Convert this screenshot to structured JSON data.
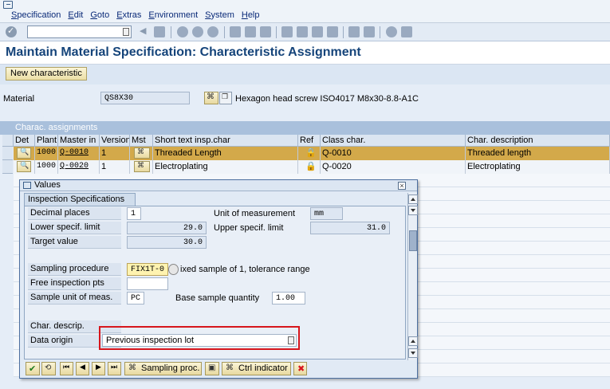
{
  "menubar": {
    "items": [
      "Specification",
      "Edit",
      "Goto",
      "Extras",
      "Environment",
      "System",
      "Help"
    ]
  },
  "titlebar": {
    "title": "Maintain Material Specification: Characteristic Assignment"
  },
  "apptoolbar": {
    "new_characteristic": "New characteristic"
  },
  "header": {
    "material_label": "Material",
    "material_value": "QS8X30",
    "material_description": "Hexagon head screw ISO4017 M8x30-8.8-A1C"
  },
  "assignments": {
    "title": "Charac. assignments",
    "columns": [
      "Det",
      "Plant",
      "Master in",
      "Version",
      "Mst",
      "Short text insp.char",
      "Ref",
      "Class char.",
      "Char. description"
    ],
    "rows": [
      {
        "plant": "1000",
        "master": "Q-0010",
        "version": "1",
        "short_text": "Threaded Length",
        "class_char": "Q-0010",
        "description": "Threaded length"
      },
      {
        "plant": "1000",
        "master": "Q-0020",
        "version": "1",
        "short_text": "Electroplating",
        "class_char": "Q-0020",
        "description": "Electroplating"
      }
    ]
  },
  "dialog": {
    "title": "Values",
    "tab": "Inspection Specifications",
    "decimal_places_label": "Decimal places",
    "decimal_places": "1",
    "uom_label": "Unit of measurement",
    "uom": "mm",
    "lower_limit_label": "Lower specif. limit",
    "lower_limit": "29.0",
    "upper_limit_label": "Upper specif. limit",
    "upper_limit": "31.0",
    "target_label": "Target value",
    "target": "30.0",
    "sampling_label": "Sampling procedure",
    "sampling_value": "FIX1T-0",
    "sampling_desc": "ixed sample of 1, tolerance range",
    "free_pts_label": "Free inspection pts",
    "sample_unit_label": "Sample unit of meas.",
    "sample_unit": "PC",
    "base_qty_label": "Base sample quantity",
    "base_qty": "1.00",
    "char_descrip_label": "Char. descrip.",
    "data_origin_label": "Data origin",
    "data_origin": "Previous inspection lot",
    "footer": {
      "sampling_proc": "Sampling proc.",
      "ctrl_indicator": "Ctrl indicator"
    }
  },
  "colors": {
    "title": "#15447a",
    "highlight_row": "#d3a94a",
    "red_box": "#d7161c"
  }
}
